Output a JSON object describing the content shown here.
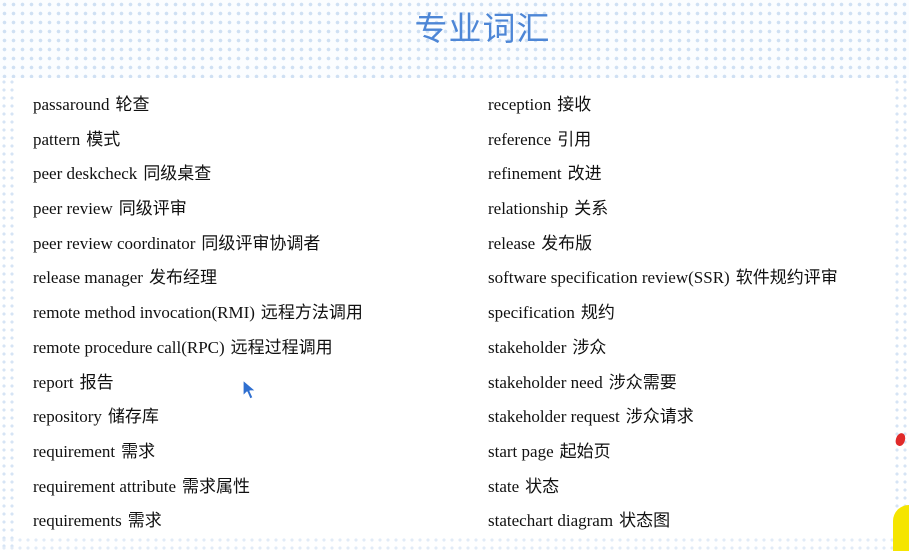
{
  "title": "专业词汇",
  "left_terms": [
    {
      "en": "passaround",
      "zh": "轮查"
    },
    {
      "en": "pattern",
      "zh": "模式"
    },
    {
      "en": "peer deskcheck",
      "zh": "同级桌查"
    },
    {
      "en": "peer review",
      "zh": "同级评审"
    },
    {
      "en": "peer review coordinator",
      "zh": "同级评审协调者"
    },
    {
      "en": "release manager",
      "zh": "发布经理"
    },
    {
      "en": "remote method invocation(RMI)",
      "zh": "远程方法调用"
    },
    {
      "en": "remote procedure call(RPC)",
      "zh": "远程过程调用"
    },
    {
      "en": "report",
      "zh": "报告"
    },
    {
      "en": "repository",
      "zh": "储存库"
    },
    {
      "en": "requirement",
      "zh": "需求"
    },
    {
      "en": "requirement attribute",
      "zh": "需求属性"
    },
    {
      "en": "requirements",
      "zh": "需求"
    }
  ],
  "right_terms": [
    {
      "en": "reception",
      "zh": "接收"
    },
    {
      "en": "reference",
      "zh": "引用"
    },
    {
      "en": "refinement",
      "zh": "改进"
    },
    {
      "en": "relationship",
      "zh": "关系"
    },
    {
      "en": "release",
      "zh": "发布版"
    },
    {
      "en": "software specification review(SSR)",
      "zh": "软件规约评审"
    },
    {
      "en": "specification",
      "zh": "规约"
    },
    {
      "en": "stakeholder",
      "zh": "涉众"
    },
    {
      "en": "stakeholder need",
      "zh": "涉众需要"
    },
    {
      "en": "stakeholder request",
      "zh": "涉众请求"
    },
    {
      "en": "start page",
      "zh": "起始页"
    },
    {
      "en": "state",
      "zh": "状态"
    },
    {
      "en": "statechart diagram",
      "zh": "状态图"
    }
  ],
  "colors": {
    "title": "#4d86d6",
    "text": "#111111",
    "pattern": "#cfe0f3",
    "marker_red": "#e02a2a",
    "marker_yellow": "#f5e500"
  },
  "icons": {
    "cursor": "mouse-pointer-icon"
  }
}
